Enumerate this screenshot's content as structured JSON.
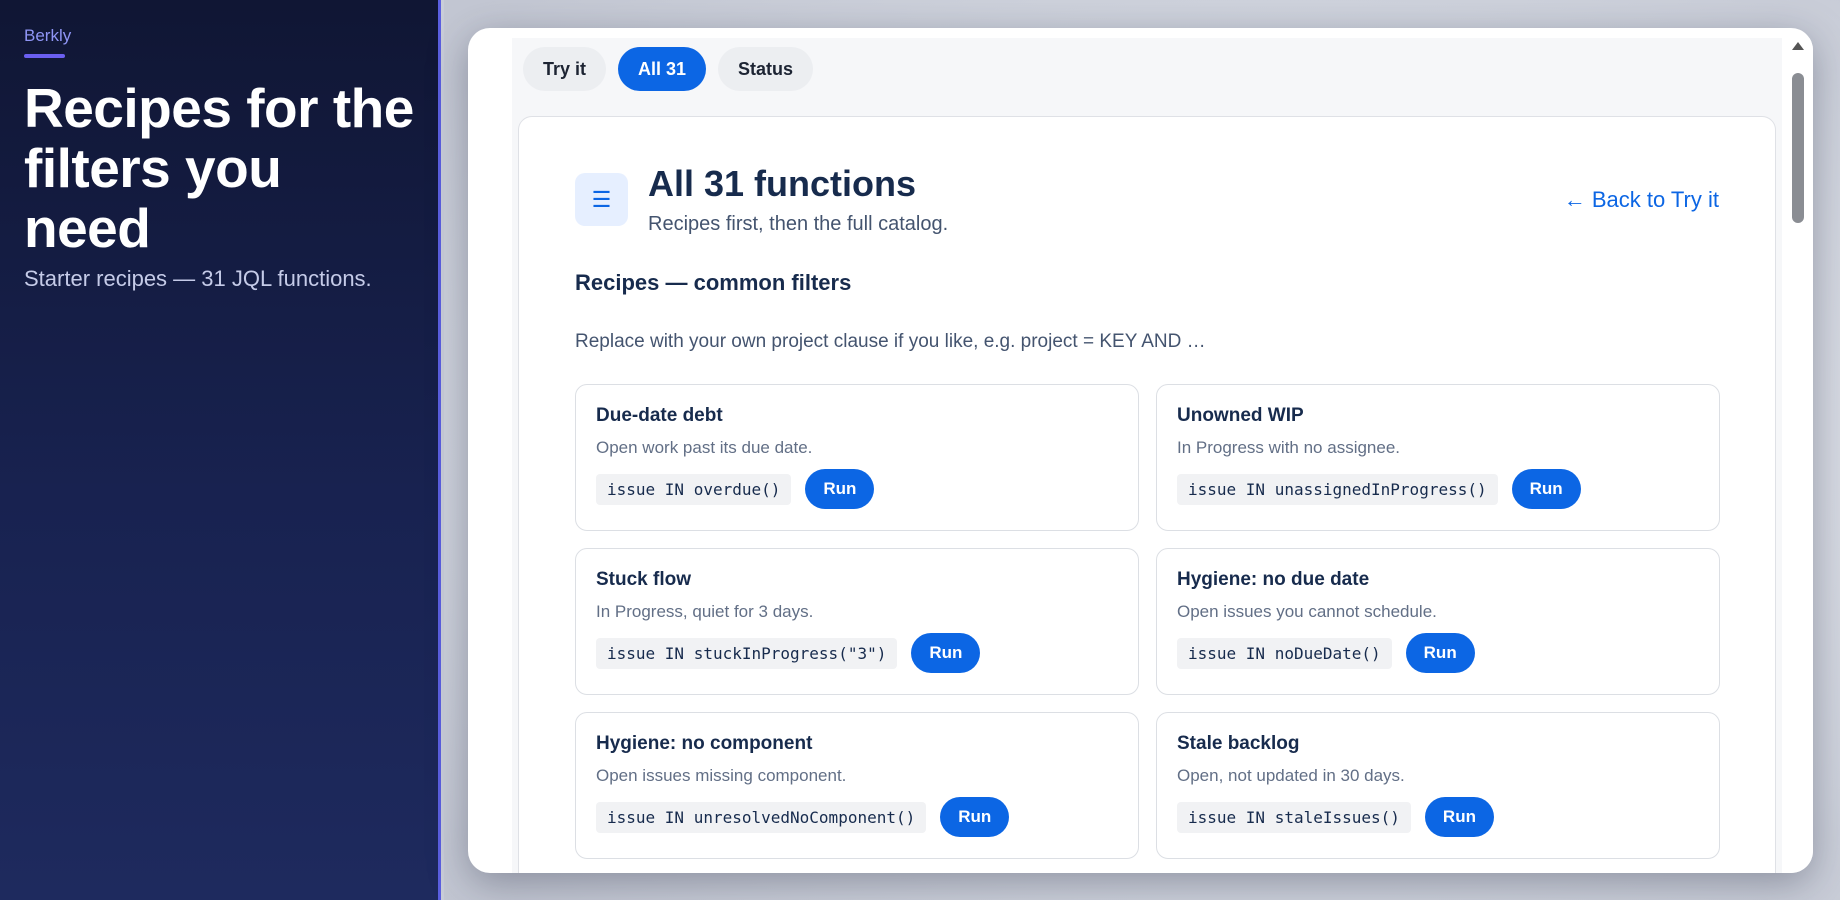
{
  "hero": {
    "brand": "Berkly",
    "title": "Recipes for the filters you need",
    "subtitle": "Starter recipes — 31 JQL functions."
  },
  "tabs": [
    {
      "label": "Try it",
      "active": false
    },
    {
      "label": "All 31",
      "active": true
    },
    {
      "label": "Status",
      "active": false
    }
  ],
  "card": {
    "icon": "list-icon",
    "title": "All 31 functions",
    "subtitle": "Recipes first, then the full catalog.",
    "back_link": "← Back to Try it",
    "section_title": "Recipes — common filters",
    "section_hint": "Replace with your own project clause if you like, e.g. project = KEY AND …"
  },
  "recipes": [
    {
      "title": "Due-date debt",
      "desc": "Open work past its due date.",
      "code": "issue IN overdue()",
      "run": "Run"
    },
    {
      "title": "Unowned WIP",
      "desc": "In Progress with no assignee.",
      "code": "issue IN unassignedInProgress()",
      "run": "Run"
    },
    {
      "title": "Stuck flow",
      "desc": "In Progress, quiet for 3 days.",
      "code": "issue IN stuckInProgress(\"3\")",
      "run": "Run"
    },
    {
      "title": "Hygiene: no due date",
      "desc": "Open issues you cannot schedule.",
      "code": "issue IN noDueDate()",
      "run": "Run"
    },
    {
      "title": "Hygiene: no component",
      "desc": "Open issues missing component.",
      "code": "issue IN unresolvedNoComponent()",
      "run": "Run"
    },
    {
      "title": "Stale backlog",
      "desc": "Open, not updated in 30 days.",
      "code": "issue IN staleIssues()",
      "run": "Run"
    }
  ],
  "colors": {
    "accent": "#0c66e4",
    "hero_bg": "#101634",
    "brand": "#8f95f5"
  }
}
